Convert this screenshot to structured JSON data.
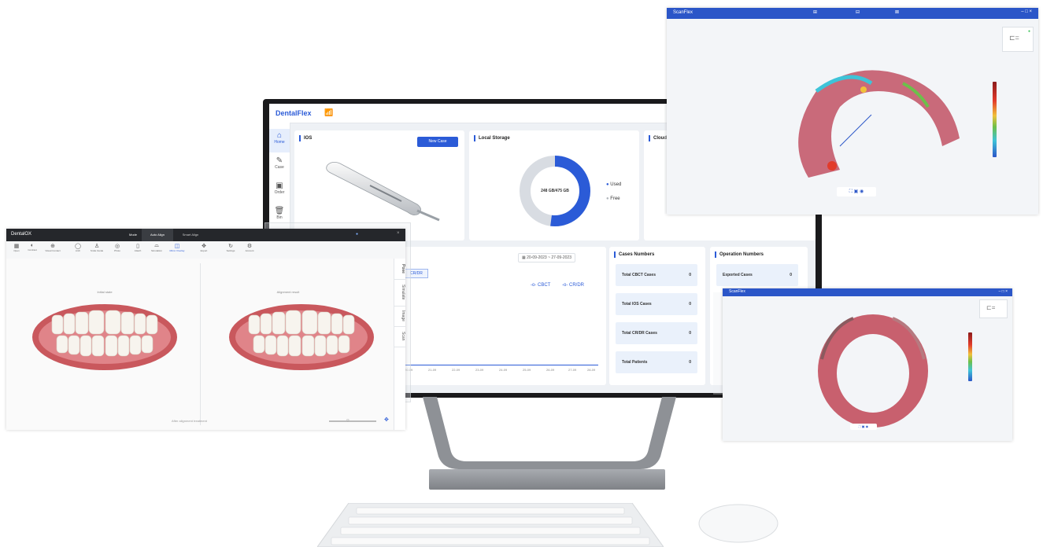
{
  "dentalflex": {
    "logo": "DentalFlex",
    "sidebar": [
      {
        "label": "Home",
        "icon": "home-icon"
      },
      {
        "label": "Case",
        "icon": "case-icon"
      },
      {
        "label": "Order",
        "icon": "order-icon"
      },
      {
        "label": "Bin",
        "icon": "bin-icon"
      }
    ],
    "ios": {
      "title": "IOS",
      "button": "New Case"
    },
    "storage": {
      "title": "Local Storage",
      "center_text": "248 GB/475 GB",
      "used_fraction": 0.52,
      "legend_used": "Used",
      "legend_free": "Free"
    },
    "cloud": {
      "title": "Cloud S"
    },
    "chart": {
      "date_range": "20-09-2023 ~ 27-09-2023",
      "tab_label": "CR/DR",
      "legend": [
        "CBCT",
        "CR/DR"
      ],
      "xticks": [
        "20-09",
        "21-09",
        "22-09",
        "23-09",
        "24-09",
        "25-09",
        "26-09",
        "27-09",
        "28-09"
      ]
    },
    "cases": {
      "title": "Cases Numbers",
      "rows": [
        {
          "label": "Total CBCT Cases",
          "value": "0"
        },
        {
          "label": "Total IOS Cases",
          "value": "0"
        },
        {
          "label": "Total CR/DR Cases",
          "value": "0"
        },
        {
          "label": "Total Patients",
          "value": "0"
        }
      ]
    },
    "operations": {
      "title": "Operation Numbers",
      "rows": [
        {
          "label": "Exported Cases",
          "value": "0"
        }
      ]
    }
  },
  "dentalox": {
    "app_name": "DentalOX",
    "tabs": [
      "Mode",
      "Auto Align",
      "Smart Align"
    ],
    "tools": [
      "Open",
      "Contrast",
      "Visual Contact",
      "Arch",
      "Smile Guide",
      "Photo",
      "Attach",
      "Simulation",
      "Mirror Overlay",
      "Export",
      "Settings",
      "Account"
    ],
    "side_tabs": [
      "Pose",
      "Simulate",
      "Image",
      "Scan"
    ],
    "left_label": "Initial state",
    "right_label": "Alignment result",
    "footer": "After alignment treatment"
  },
  "scan_top": {
    "title": "ScanFlex"
  },
  "scan_bottom": {
    "title": "ScanFlex"
  },
  "colors": {
    "accent": "#2b5bd7",
    "scan_bar": "#2b56c8",
    "donut_free": "#d8dce2"
  }
}
